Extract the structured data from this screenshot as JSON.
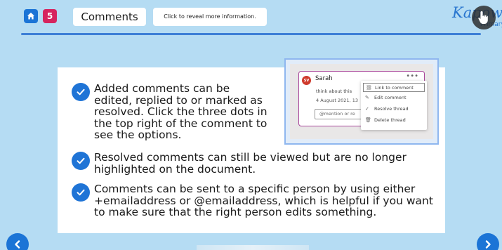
{
  "header": {
    "slide_number": "5",
    "title": "Comments",
    "reveal_button": "Click to reveal more information.",
    "brand_text": "Kapow",
    "brand_sub": "Primary"
  },
  "bullets": [
    "Added comments can be edited, replied to or marked as resolved. Click the three dots in the top right of the comment to see the options.",
    "Resolved comments can still be viewed but are no longer highlighted on the document.",
    "Comments can be sent to a specific person by using either +emailaddress or @emailaddress, which is helpful if you want to make sure that the right person edits something."
  ],
  "comment_preview": {
    "avatar_initials": "SV",
    "author": "Sarah",
    "dots": "•••",
    "text": "think about this",
    "date": "4 August 2021, 13",
    "input_placeholder": "@mention or re",
    "menu": [
      "Link to comment",
      "Edit comment",
      "Resolve thread",
      "Delete thread"
    ]
  },
  "colors": {
    "background": "#b5dcf3",
    "accent_blue": "#1b74d6",
    "badge_pink": "#d6245e",
    "comment_border": "#a9479b"
  }
}
